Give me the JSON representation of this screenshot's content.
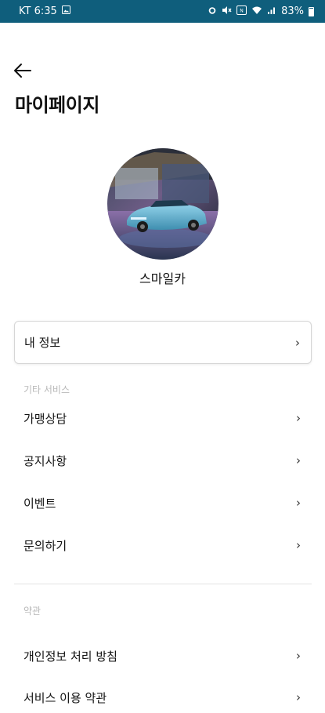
{
  "status_bar": {
    "carrier_time": "KT 6:35",
    "battery_text": "83%",
    "background_color": "#0f5e7c",
    "icons": [
      "image-icon",
      "alarm-icon",
      "mute-icon",
      "nfc-icon",
      "wifi-icon",
      "signal-icon",
      "battery-icon"
    ]
  },
  "header": {
    "back_icon": "arrow-left-icon",
    "title": "마이페이지"
  },
  "profile": {
    "name": "스마일카"
  },
  "my_info": {
    "label": "내 정보"
  },
  "other_services": {
    "header": "기타 서비스",
    "items": [
      {
        "label": "가맹상담"
      },
      {
        "label": "공지사항"
      },
      {
        "label": "이벤트"
      },
      {
        "label": "문의하기"
      }
    ]
  },
  "terms": {
    "header": "약관",
    "items": [
      {
        "label": "개인정보 처리 방침"
      },
      {
        "label": "서비스 이용 약관"
      }
    ]
  },
  "chevron_glyph": "›"
}
